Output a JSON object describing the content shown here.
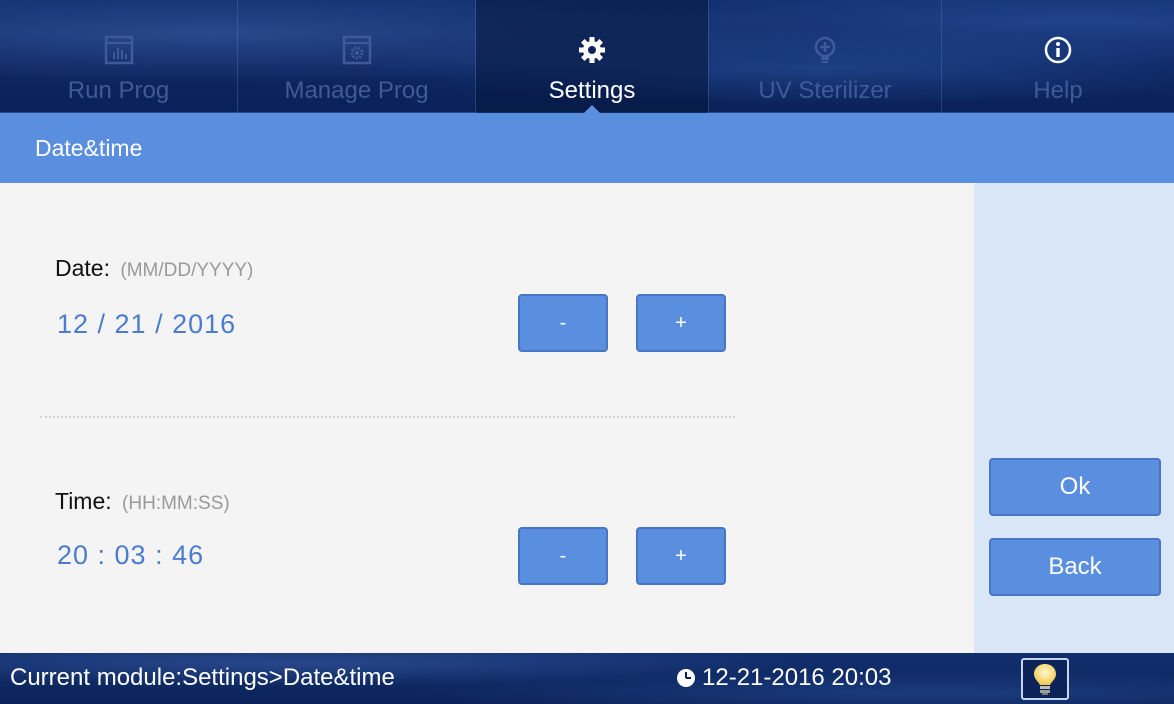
{
  "nav": {
    "tabs": [
      {
        "label": "Run Prog",
        "icon": "chart-icon",
        "active": false
      },
      {
        "label": "Manage Prog",
        "icon": "gear-window-icon",
        "active": false
      },
      {
        "label": "Settings",
        "icon": "gear-icon",
        "active": true
      },
      {
        "label": "UV Sterilizer",
        "icon": "bulb-plus-icon",
        "active": false
      },
      {
        "label": "Help",
        "icon": "info-icon",
        "active": false
      }
    ]
  },
  "header": {
    "title": "Date&time"
  },
  "date": {
    "label": "Date:",
    "format": "(MM/DD/YYYY)",
    "value": "12 / 21 / 2016",
    "minus_label": "-",
    "plus_label": "+"
  },
  "time": {
    "label": "Time:",
    "format": "(HH:MM:SS)",
    "value": "20 : 03 : 46",
    "minus_label": "-",
    "plus_label": "+"
  },
  "actions": {
    "ok_label": "Ok",
    "back_label": "Back"
  },
  "status": {
    "module_text": "Current module:Settings>Date&time",
    "datetime": "12-21-2016 20:03",
    "lamp_icon": "lightbulb-icon"
  },
  "colors": {
    "accent": "#5a8fe0",
    "value_text": "#4a7ccf",
    "nav_bg": "#0f2d6b",
    "side_panel": "#d9e6f8"
  }
}
